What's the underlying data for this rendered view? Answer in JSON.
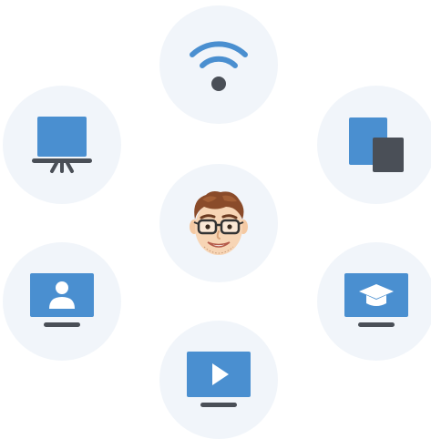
{
  "colors": {
    "circle_background": "#f1f5fa",
    "accent_blue": "#4a8fd0",
    "dark_gray": "#4a4f57",
    "page_background": "#ffffff"
  },
  "hub": {
    "center": {
      "icon": "memoji-avatar-with-glasses"
    },
    "satellites": [
      {
        "id": "wifi",
        "icon": "wifi-icon"
      },
      {
        "id": "devices",
        "icon": "devices-icon"
      },
      {
        "id": "education",
        "icon": "graduation-cap-monitor-icon"
      },
      {
        "id": "video",
        "icon": "play-monitor-icon"
      },
      {
        "id": "user",
        "icon": "user-monitor-icon"
      },
      {
        "id": "presentation",
        "icon": "projector-screen-icon"
      }
    ]
  }
}
